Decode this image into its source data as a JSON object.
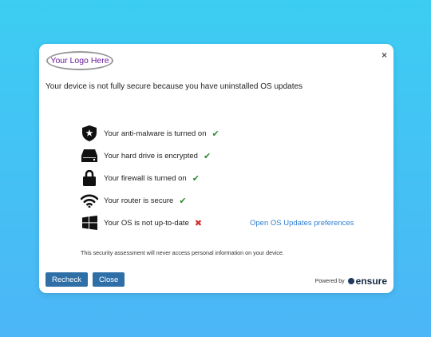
{
  "logo": {
    "text": "Your Logo Here"
  },
  "headline": "Your device is not fully secure because you have uninstalled OS updates",
  "checks": [
    {
      "label": "Your anti-malware is turned on",
      "status": "pass",
      "icon": "shield-icon"
    },
    {
      "label": "Your hard drive is encrypted",
      "status": "pass",
      "icon": "hard-drive-icon"
    },
    {
      "label": "Your firewall is turned on",
      "status": "pass",
      "icon": "lock-icon"
    },
    {
      "label": "Your router is secure",
      "status": "pass",
      "icon": "wifi-icon"
    },
    {
      "label": "Your OS is not up-to-date",
      "status": "fail",
      "icon": "windows-icon"
    }
  ],
  "os_link": "Open OS Updates preferences",
  "disclaimer": "This security assessment will never access personal information on your device.",
  "buttons": {
    "recheck": "Recheck",
    "close": "Close"
  },
  "powered_by": {
    "prefix": "Powered by",
    "brand": "ensure"
  },
  "marks": {
    "pass": "✔",
    "fail": "✖"
  },
  "close_glyph": "×",
  "colors": {
    "accent": "#2f6fa8",
    "pass": "#2e8b2e",
    "fail": "#d32f2f",
    "link": "#2f7fd0"
  }
}
